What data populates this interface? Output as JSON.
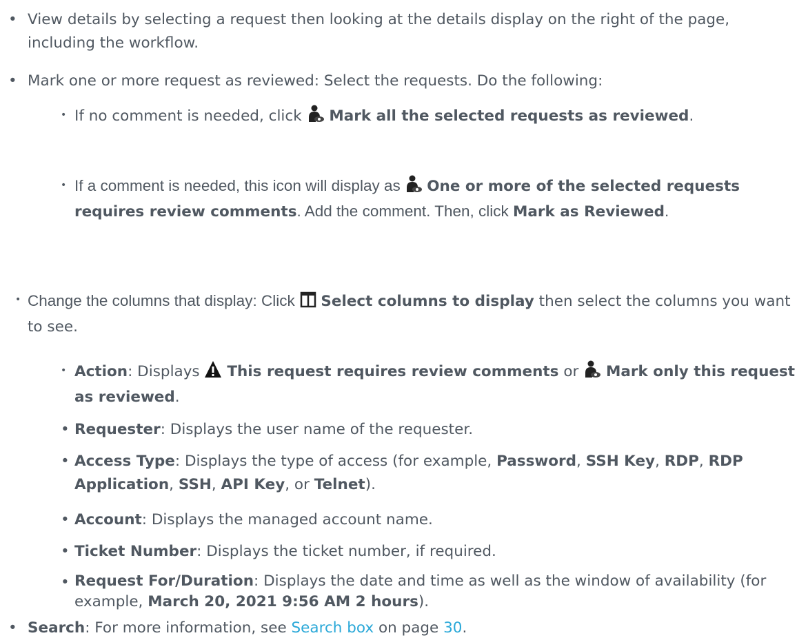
{
  "items": [
    {
      "text": "View details by selecting a request then looking at the details display on the right of the page, including the workflow."
    },
    {
      "text": "Mark one or more request as reviewed: Select the requests. Do the following:"
    }
  ],
  "sub_mark": [
    {
      "prefix": "If no comment is needed, click",
      "bold": "Mark all the selected requests as reviewed",
      "suffix": ".",
      "icon": "reviewer-eye-icon"
    },
    {
      "prefix": "If a comment is needed, this icon will display as",
      "bold": "One or more of the selected requests requires review comments",
      "mid": ". Add the comment. Then, click",
      "bold2": "Mark as Reviewed",
      "suffix": ".",
      "icon": "reviewer-eye-icon"
    }
  ],
  "columns_item": {
    "prefix": "Change the columns that display: Click",
    "bold": "Select columns to display",
    "suffix": "then select the columns you want to see.",
    "icon": "columns-icon"
  },
  "column_defs": [
    {
      "label": "Action",
      "text": ": Displays",
      "bold1": "This request requires review comments",
      "or": "or",
      "bold2": "Mark only this request as reviewed",
      "end": ".",
      "icon1": "warning-icon",
      "icon2": "reviewer-eye-icon"
    },
    {
      "label": "Requester",
      "text": ": Displays the user name of the requester."
    },
    {
      "label": "Access Type",
      "text": ": Displays the type of access (for example,",
      "types": [
        "Password",
        "SSH Key",
        "RDP",
        "RDP Application",
        "SSH",
        "API Key",
        "Telnet"
      ],
      "sep": ", ",
      "or": "or",
      "end": ")."
    },
    {
      "label": "Account",
      "text": ": Displays the managed account name."
    },
    {
      "label": "Ticket Number",
      "text": ": Displays the ticket number, if required."
    },
    {
      "label": "Request For/Duration",
      "text": ": Displays the date and time as well as the window of availability (for example,",
      "example": "March 20, 2021 9:56 AM 2 hours",
      "end": ")."
    }
  ],
  "search_item": {
    "label": "Search",
    "text": ": For more information, see",
    "link": "Search box",
    "page_text": "on page",
    "page": "30",
    "end": "."
  }
}
